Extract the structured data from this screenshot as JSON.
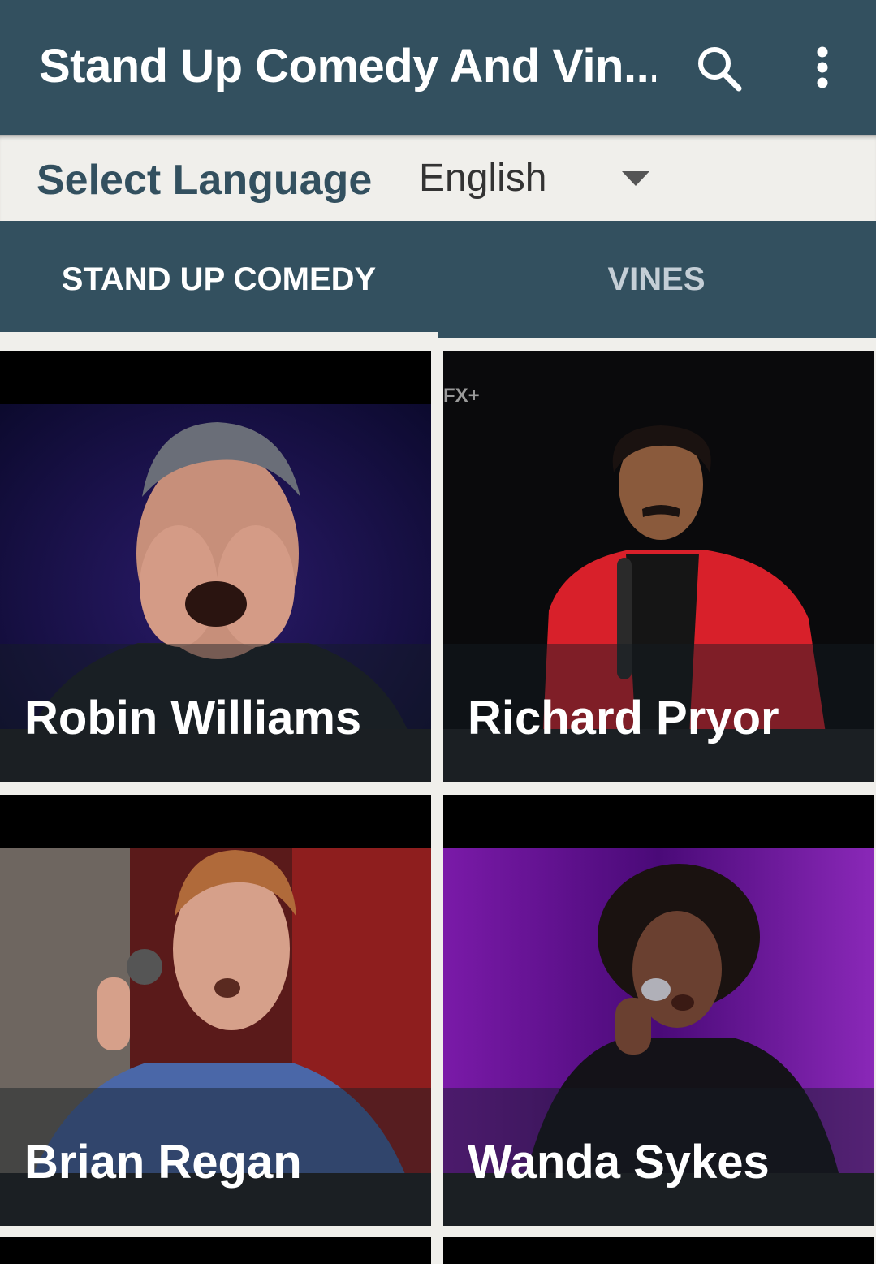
{
  "appbar": {
    "title": "Stand Up Comedy And Vin...",
    "search_icon": "search-icon",
    "menu_icon": "more-vert-icon"
  },
  "language": {
    "label": "Select Language",
    "selected": "English",
    "caret_icon": "dropdown-caret-icon"
  },
  "tabs": [
    {
      "label": "STAND UP COMEDY",
      "selected": true
    },
    {
      "label": "VINES",
      "selected": false
    }
  ],
  "comedians": [
    {
      "name": "Robin Williams"
    },
    {
      "name": "Richard Pryor",
      "watermark": "FX+"
    },
    {
      "name": "Brian Regan"
    },
    {
      "name": "Wanda Sykes"
    }
  ],
  "colors": {
    "primary": "#33505f",
    "background": "#f0efeb",
    "tab_active_text": "#ffffff",
    "tab_inactive_text": "#c4ced6"
  }
}
